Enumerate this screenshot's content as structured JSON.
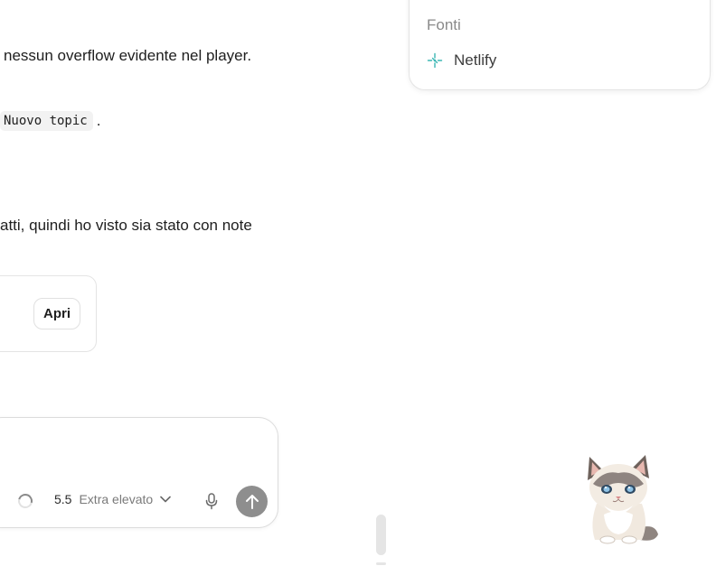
{
  "chat": {
    "line1": "nessun overflow evidente nel player.",
    "code_chip": "Nuovo topic",
    "code_period": ".",
    "line3": "atti, quindi ho visto sia stato con note"
  },
  "file_card": {
    "open_label": "Apri"
  },
  "sources": {
    "title": "Fonti",
    "items": [
      {
        "label": "Netlify",
        "icon": "netlify-icon",
        "color": "#3bb7b4"
      }
    ]
  },
  "composer": {
    "model_version": "5.5",
    "reasoning_level": "Extra elevato",
    "send_color": "#8e8e8e"
  }
}
